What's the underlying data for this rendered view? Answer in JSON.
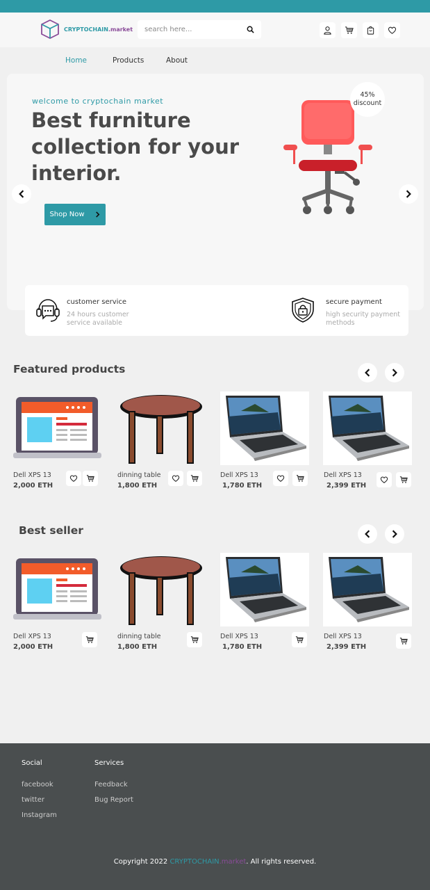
{
  "brand": {
    "name_part1": "CRYPTOCHAIN",
    "name_part2": ".market",
    "primary_color": "#2e9aa6",
    "secondary_color": "#8a4c99"
  },
  "header": {
    "search_placeholder": "search here...",
    "icons": [
      "user-icon",
      "cart-icon",
      "bag-icon",
      "heart-icon"
    ]
  },
  "nav": {
    "items": [
      {
        "label": "Home",
        "active": true
      },
      {
        "label": "Products",
        "active": false
      },
      {
        "label": "About",
        "active": false
      }
    ]
  },
  "hero": {
    "welcome": "welcome to cryptochain market",
    "title": "Best furniture collection for your interior.",
    "cta": "Shop Now",
    "discount_value": "45%",
    "discount_label": "discount"
  },
  "services": [
    {
      "title": "customer service",
      "desc": "24 hours customer service available",
      "icon": "headset-icon"
    },
    {
      "title": "secure payment",
      "desc": "high security payment methods",
      "icon": "shield-lock-icon"
    }
  ],
  "featured": {
    "title": "Featured products",
    "products": [
      {
        "name": "Dell XPS 13",
        "price": "2,000 ETH",
        "image": "laptop-illustration"
      },
      {
        "name": "dinning table",
        "price": "1,800 ETH",
        "image": "table-illustration"
      },
      {
        "name": "Dell XPS 13",
        "price": "1,780 ETH",
        "image": "laptop-photo"
      },
      {
        "name": "Dell XPS 13",
        "price": "2,399 ETH",
        "image": "laptop-photo"
      }
    ]
  },
  "bestseller": {
    "title": "Best seller",
    "products": [
      {
        "name": "Dell XPS 13",
        "price": "2,000 ETH",
        "image": "laptop-illustration"
      },
      {
        "name": "dinning table",
        "price": "1,800 ETH",
        "image": "table-illustration"
      },
      {
        "name": "Dell XPS 13",
        "price": "1,780 ETH",
        "image": "laptop-photo"
      },
      {
        "name": "Dell XPS 13",
        "price": "2,399 ETH",
        "image": "laptop-photo"
      }
    ]
  },
  "footer": {
    "social_heading": "Social",
    "social_links": [
      "facebook",
      "twitter",
      "Instagram"
    ],
    "services_heading": "Services",
    "services_links": [
      "Feedback",
      "Bug Report"
    ],
    "copyright_prefix": "Copyright 2022 ",
    "copyright_brand1": "CRYPTOCHAIN",
    "copyright_brand2": ".market",
    "copyright_suffix": ". All rights reserved."
  }
}
